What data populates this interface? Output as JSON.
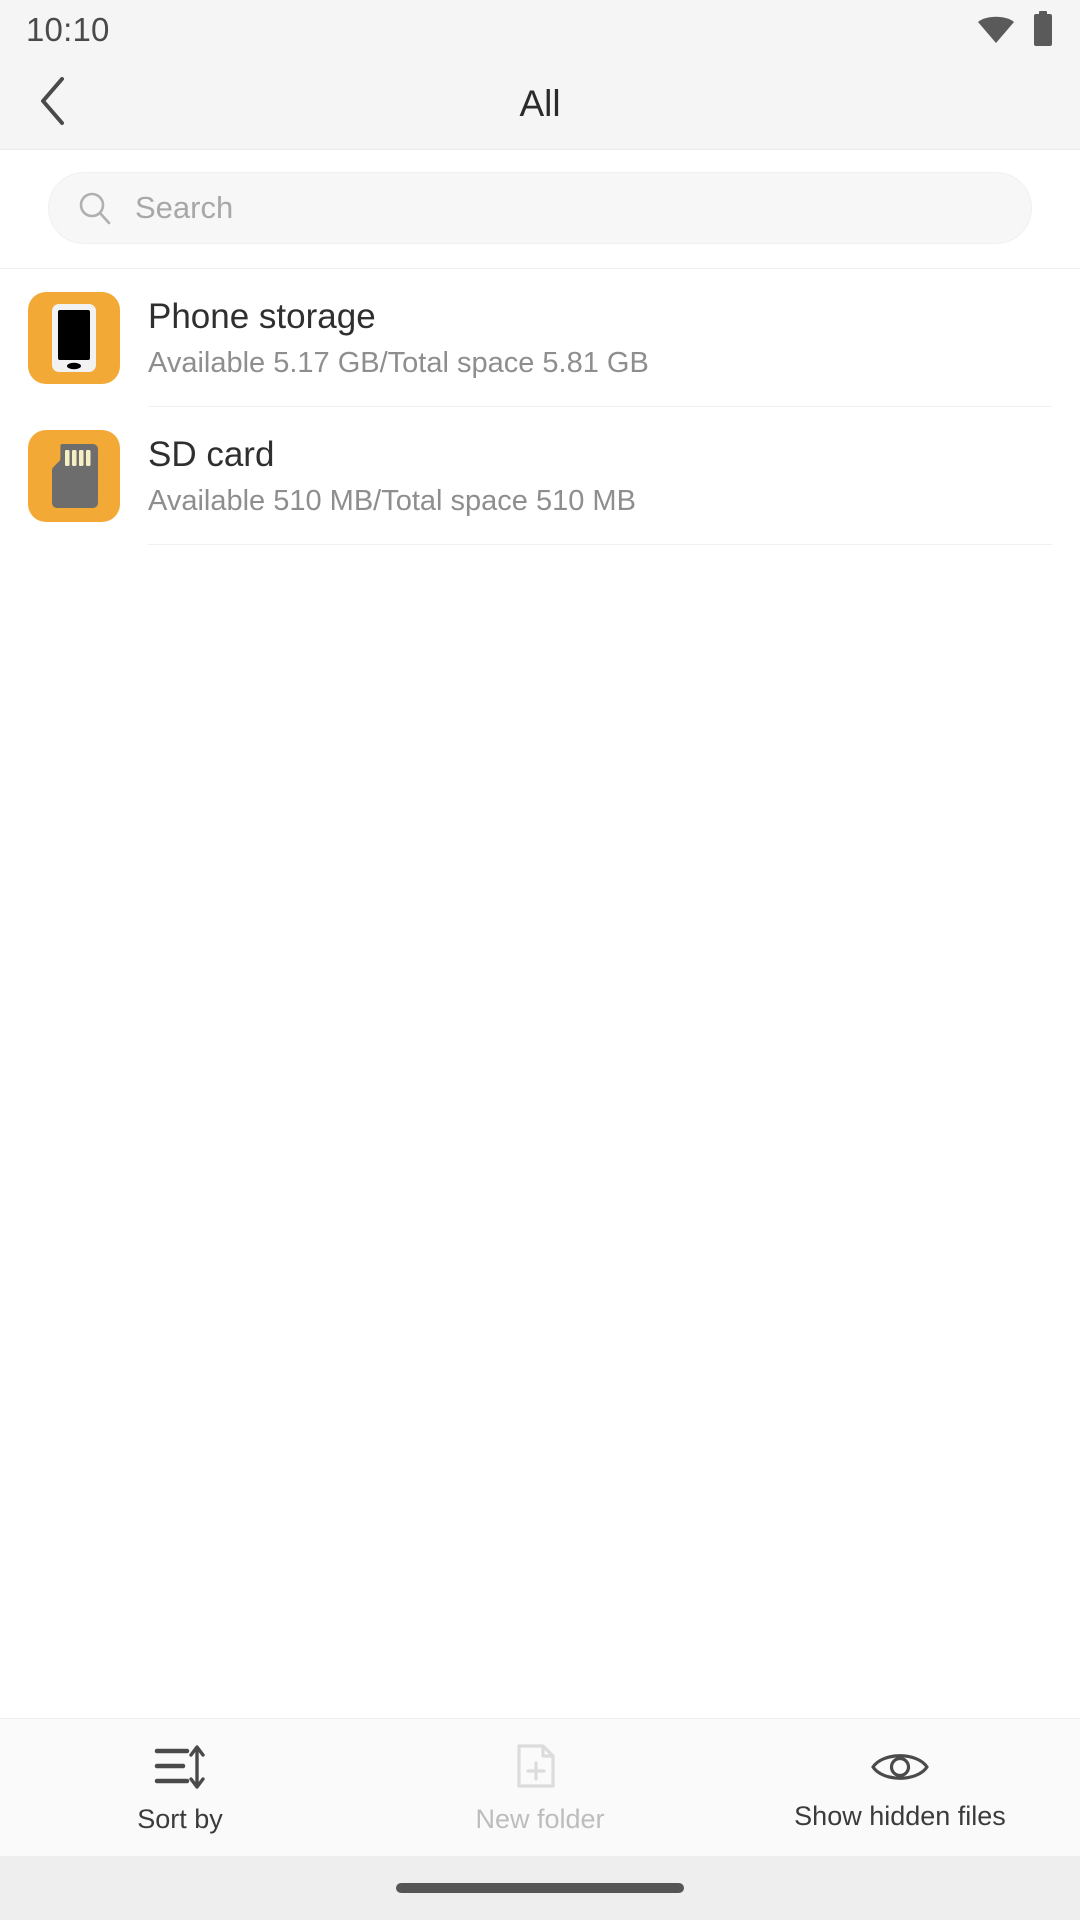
{
  "status_bar": {
    "clock": "10:10",
    "wifi_icon": "wifi-icon",
    "battery_icon": "battery-full-icon"
  },
  "app_bar": {
    "back_icon": "back-chevron-icon",
    "title": "All"
  },
  "search": {
    "icon": "search-icon",
    "placeholder": "Search",
    "value": ""
  },
  "storage_list": [
    {
      "icon": "phone-storage-icon",
      "title": "Phone storage",
      "subtitle": "Available 5.17 GB/Total space 5.81 GB"
    },
    {
      "icon": "sd-card-icon",
      "title": "SD card",
      "subtitle": "Available 510 MB/Total space 510 MB"
    }
  ],
  "bottom_bar": {
    "actions": [
      {
        "icon": "sort-icon",
        "label": "Sort by",
        "enabled": true
      },
      {
        "icon": "new-folder-icon",
        "label": "New folder",
        "enabled": false
      },
      {
        "icon": "eye-icon",
        "label": "Show hidden files",
        "enabled": true
      }
    ]
  },
  "colors": {
    "accent_orange": "#f3a935",
    "status_bg": "#f5f5f5",
    "title_text": "#2f2f2f",
    "subtitle_text": "#8e8e8e",
    "disabled_text": "#bdbdbd"
  }
}
